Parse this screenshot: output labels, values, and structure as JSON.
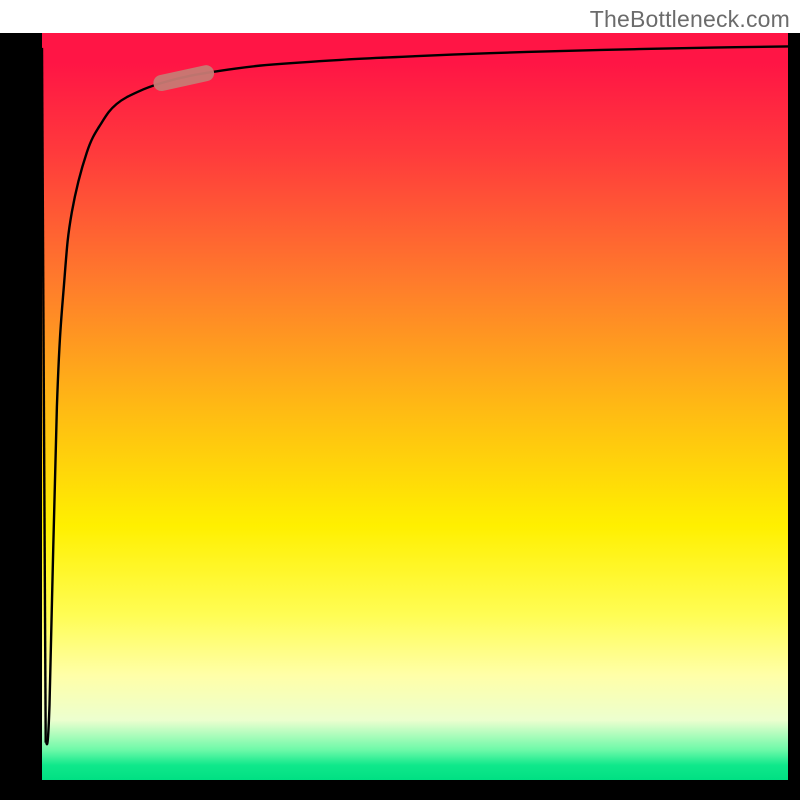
{
  "watermark": "TheBottleneck.com",
  "colors": {
    "border": "#000000",
    "curve": "#000000",
    "capsule": "#c77a74",
    "gradient_top": "#ff1545",
    "gradient_mid_orange": "#ff8a20",
    "gradient_mid_yellow": "#fff000",
    "gradient_bottom": "#00e083"
  },
  "chart_data": {
    "type": "line",
    "title": "",
    "xlabel": "",
    "ylabel": "",
    "xlim": [
      0,
      100
    ],
    "ylim": [
      0,
      100
    ],
    "series": [
      {
        "name": "curve",
        "x": [
          0,
          0.5,
          1,
          2,
          3,
          4,
          6,
          8,
          10,
          13,
          16,
          20,
          25,
          30,
          40,
          50,
          60,
          70,
          80,
          90,
          100
        ],
        "y": [
          98,
          5,
          10,
          50,
          67,
          76,
          84,
          88,
          90.5,
          92.2,
          93.3,
          94.3,
          95.1,
          95.7,
          96.4,
          96.9,
          97.3,
          97.6,
          97.85,
          98.05,
          98.2
        ]
      }
    ],
    "annotations": [
      {
        "name": "highlight-capsule",
        "x_range": [
          16,
          22
        ],
        "note": "small rounded highlight on curve"
      }
    ]
  }
}
